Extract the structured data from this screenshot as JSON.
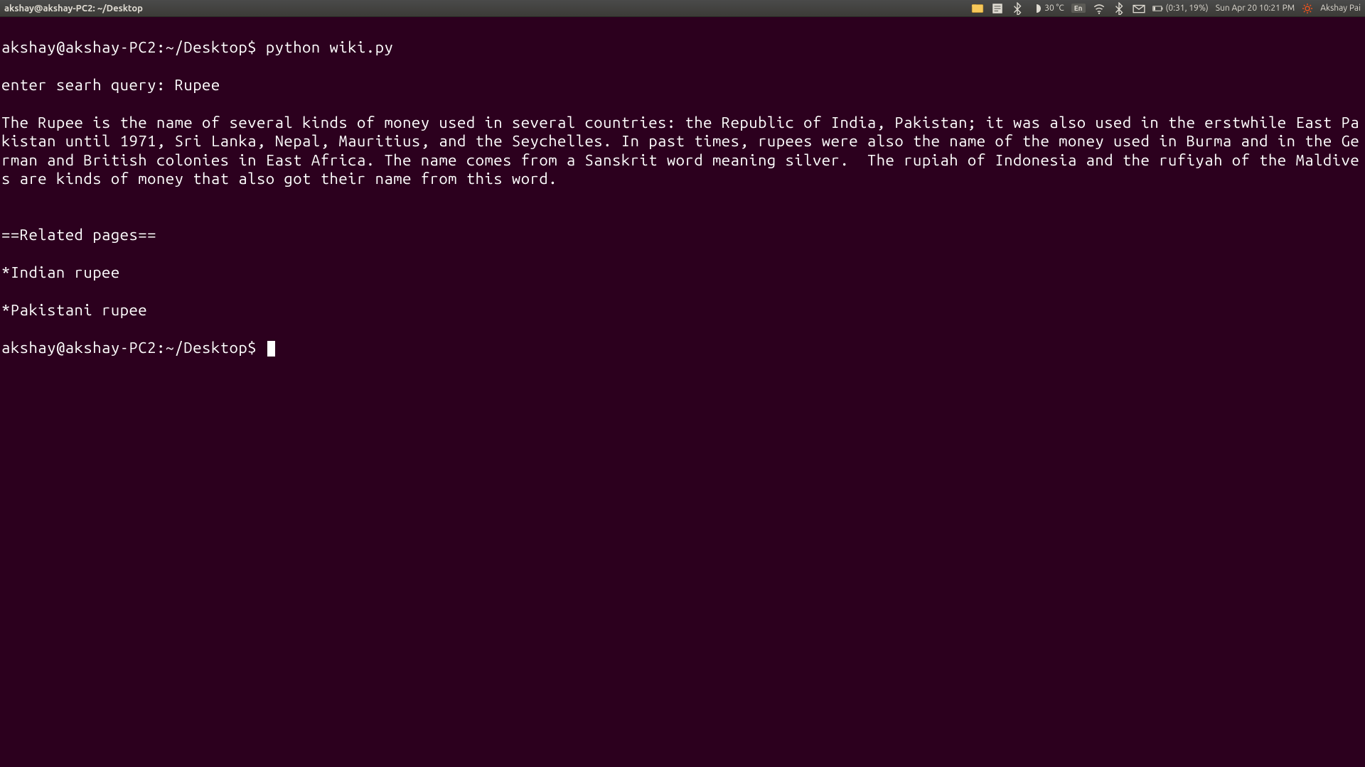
{
  "titlebar": {
    "window_title": "akshay@akshay-PC2: ~/Desktop",
    "temperature": "30 °C",
    "keyboard_layout": "En",
    "battery": "(0:31, 19%)",
    "datetime": "Sun Apr 20 10:21 PM",
    "username": "Akshay Pai"
  },
  "terminal": {
    "line1": "akshay@akshay-PC2:~/Desktop$ python wiki.py",
    "line2": "enter searh query: Rupee",
    "line3": "The Rupee is the name of several kinds of money used in several countries: the Republic of India, Pakistan; it was also used in the erstwhile East Pakistan until 1971, Sri Lanka, Nepal, Mauritius, and the Seychelles. In past times, rupees were also the name of the money used in Burma and in the German and British colonies in East Africa. The name comes from a Sanskrit word meaning silver.  The rupiah of Indonesia and the rufiyah of the Maldives are kinds of money that also got their name from this word.",
    "line4": "",
    "line5": "==Related pages==",
    "line6": "*Indian rupee",
    "line7": "*Pakistani rupee",
    "line8": "akshay@akshay-PC2:~/Desktop$ "
  }
}
